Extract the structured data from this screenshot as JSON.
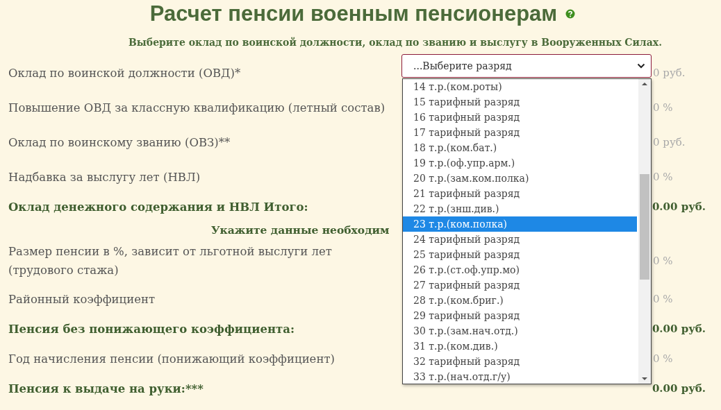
{
  "title": "Расчет пенсии военным пенсионерам",
  "subtitle": "Выберите оклад по воинской должности, оклад по званию и выслугу в Вооруженных Силах.",
  "rows": [
    {
      "kind": "field",
      "label": "Оклад по воинской должности (ОВД)*",
      "placeholder": "0 руб.",
      "select": {
        "value": "...Выберите разряд",
        "open": true,
        "options": [
          {
            "label": "14 т.р.(ком.роты)",
            "selected": false
          },
          {
            "label": "15 тарифный разряд",
            "selected": false
          },
          {
            "label": "16 тарифный разряд",
            "selected": false
          },
          {
            "label": "17 тарифный разряд",
            "selected": false
          },
          {
            "label": "18 т.р.(ком.бат.)",
            "selected": false
          },
          {
            "label": "19 т.р.(оф.упр.арм.)",
            "selected": false
          },
          {
            "label": "20 т.р.(зам.ком.полка)",
            "selected": false
          },
          {
            "label": "21 тарифный разряд",
            "selected": false
          },
          {
            "label": "22 т.р.(знш.див.)",
            "selected": false
          },
          {
            "label": "23 т.р.(ком.полка)",
            "selected": true
          },
          {
            "label": "24 тарифный разряд",
            "selected": false
          },
          {
            "label": "25 тарифный разряд",
            "selected": false
          },
          {
            "label": "26 т.р.(ст.оф.упр.мо)",
            "selected": false
          },
          {
            "label": "27 тарифный разряд",
            "selected": false
          },
          {
            "label": "28 т.р.(ком.бриг.)",
            "selected": false
          },
          {
            "label": "29 тарифный разряд",
            "selected": false
          },
          {
            "label": "30 т.р.(зам.нач.отд.)",
            "selected": false
          },
          {
            "label": "31 т.р.(ком.див.)",
            "selected": false
          },
          {
            "label": "32 тарифный разряд",
            "selected": false
          },
          {
            "label": "33 т.р.(нач.отд.г/у)",
            "selected": false
          }
        ]
      }
    },
    {
      "kind": "field",
      "label": "Повышение ОВД за классную квалификацию (летный состав)",
      "placeholder": "0 %"
    },
    {
      "kind": "field",
      "label": "Оклад по воинскому званию (ОВЗ)**",
      "placeholder": "0 руб."
    },
    {
      "kind": "field",
      "label": "Надбавка за выслугу лет (НВЛ)",
      "placeholder": "0 %"
    },
    {
      "kind": "total",
      "label": "Оклад денежного содержания и НВЛ Итого:",
      "value": "0.00 руб."
    },
    {
      "kind": "heading",
      "label": "Укажите данные необходим"
    },
    {
      "kind": "field",
      "label": "Размер пенсии в %, зависит от льготной выслуги лет (трудового стажа)",
      "placeholder": "0 %"
    },
    {
      "kind": "field",
      "label": "Районный коэффициент",
      "placeholder": "0 %"
    },
    {
      "kind": "total",
      "label": "Пенсия без понижающего коэффициента:",
      "value": "0.00 руб."
    },
    {
      "kind": "field",
      "label": "Год начисления пенсии (понижающий коэффициент)",
      "placeholder": "0 %"
    },
    {
      "kind": "total",
      "label": "Пенсия к выдаче на руки:***",
      "value": "0.00 руб."
    }
  ]
}
